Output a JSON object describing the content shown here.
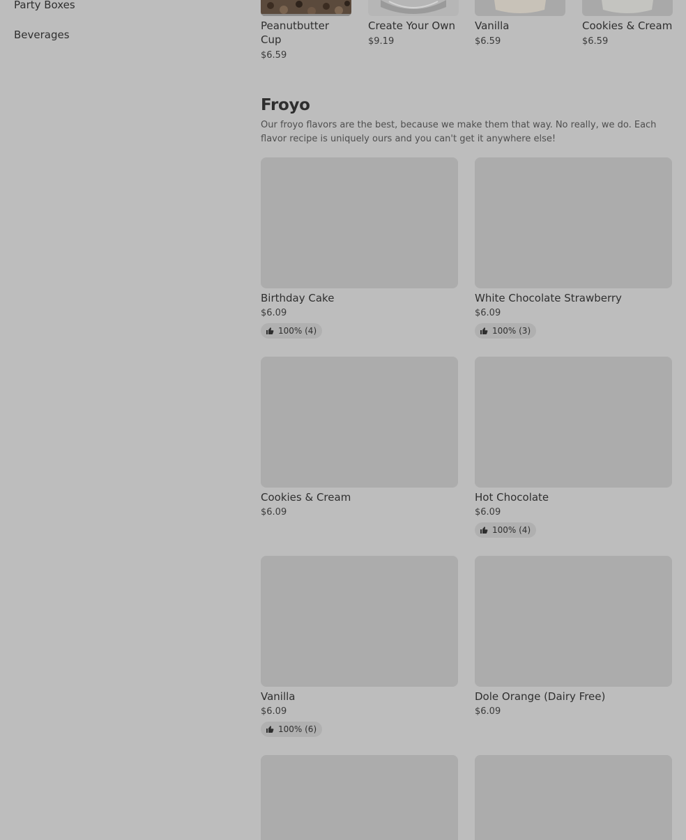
{
  "sidebar": {
    "items": [
      {
        "label": "Party Boxes"
      },
      {
        "label": "Beverages"
      }
    ]
  },
  "top_row": [
    {
      "name": "Peanutbutter Cup",
      "price": "$6.59"
    },
    {
      "name": "Create Your Own",
      "price": "$9.19"
    },
    {
      "name": "Vanilla",
      "price": "$6.59"
    },
    {
      "name": "Cookies & Cream",
      "price": "$6.59"
    }
  ],
  "section": {
    "title": "Froyo",
    "description": "Our froyo flavors are the best, because we make them that way. No really, we do. Each flavor recipe is uniquely ours and you can't get it anywhere else!"
  },
  "items": [
    {
      "name": "Birthday Cake",
      "price": "$6.09",
      "rating": "100% (4)"
    },
    {
      "name": "White Chocolate Strawberry",
      "price": "$6.09",
      "rating": "100% (3)"
    },
    {
      "name": "Cookies & Cream",
      "price": "$6.09",
      "rating": ""
    },
    {
      "name": "Hot Chocolate",
      "price": "$6.09",
      "rating": "100% (4)"
    },
    {
      "name": "Vanilla",
      "price": "$6.09",
      "rating": "100% (6)"
    },
    {
      "name": "Dole Orange (Dairy Free)",
      "price": "$6.09",
      "rating": ""
    }
  ],
  "icons": {
    "rating": "thumbs-up-icon"
  },
  "colors": {
    "overlay_background": "#bdbdbd",
    "image_placeholder": "#acacac",
    "rating_pill": "#b0b0b0"
  }
}
